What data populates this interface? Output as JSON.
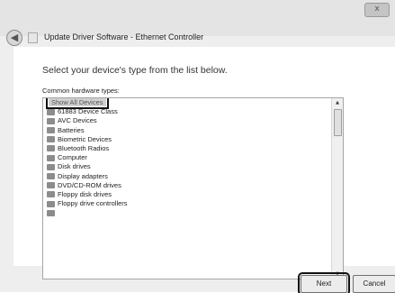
{
  "window": {
    "title": "Update Driver Software - Ethernet Controller",
    "close_glyph": "x"
  },
  "instruction": "Select your device's type from the list below.",
  "list_label": "Common hardware types:",
  "hardware_types": [
    {
      "label": "Show All Devices",
      "selected": true,
      "icon": ""
    },
    {
      "label": "61883 Device Class",
      "selected": false,
      "icon": "ieee1394-icon"
    },
    {
      "label": "AVC Devices",
      "selected": false,
      "icon": "avc-device-icon"
    },
    {
      "label": "Batteries",
      "selected": false,
      "icon": "battery-icon"
    },
    {
      "label": "Biometric Devices",
      "selected": false,
      "icon": "biometric-icon"
    },
    {
      "label": "Bluetooth Radios",
      "selected": false,
      "icon": "bluetooth-icon"
    },
    {
      "label": "Computer",
      "selected": false,
      "icon": "computer-icon"
    },
    {
      "label": "Disk drives",
      "selected": false,
      "icon": "disk-drive-icon"
    },
    {
      "label": "Display adapters",
      "selected": false,
      "icon": "display-adapter-icon"
    },
    {
      "label": "DVD/CD-ROM drives",
      "selected": false,
      "icon": "dvd-drive-icon"
    },
    {
      "label": "Floppy disk drives",
      "selected": false,
      "icon": "floppy-drive-icon"
    },
    {
      "label": "Floppy drive controllers",
      "selected": false,
      "icon": "floppy-controller-icon"
    },
    {
      "label": "",
      "selected": false,
      "icon": "device-icon"
    }
  ],
  "buttons": {
    "next": "Next",
    "cancel": "Cancel"
  }
}
